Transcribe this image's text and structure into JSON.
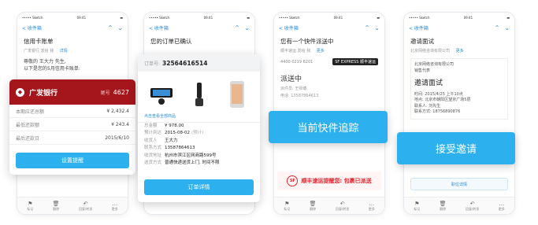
{
  "status_bar": {
    "carrier": "••••• Sketch",
    "time": "09:41"
  },
  "nav": {
    "back_label": "< 收件箱",
    "up_icon": "chevron-up",
    "down_icon": "chevron-down"
  },
  "tabbar": [
    {
      "icon": "flag-icon",
      "label": "标记"
    },
    {
      "icon": "trash-icon",
      "label": "删除"
    },
    {
      "icon": "reply-icon",
      "label": "回复/转发"
    },
    {
      "icon": "more-icon",
      "label": "更多"
    }
  ],
  "phone1": {
    "subject": "信用卡账单",
    "sender": "广发银行",
    "recipient_line": "发给 我",
    "detail_link": "详情",
    "greeting": "尊敬的 王大力 先生,",
    "intro": "以下是您的5月信用卡账单:"
  },
  "bank_card": {
    "bank_name": "广发银行",
    "tail_label": "尾号",
    "tail_number": "4627",
    "rows": [
      {
        "label": "本期应还总额",
        "value": "¥ 2,432.4"
      },
      {
        "label": "最低还款额",
        "value": "¥ 243.4"
      },
      {
        "label": "最后还款日",
        "value": "2015/6/10"
      }
    ],
    "button": "设置提醒"
  },
  "phone2": {
    "subject": "您的订单已确认"
  },
  "order_card": {
    "order_label": "订单号:",
    "order_number": "32564616514",
    "all_items": "点击查看全部商品",
    "fields": [
      {
        "k": "总金额",
        "v": "¥ 978.00",
        "note": ""
      },
      {
        "k": "预计到达",
        "v": "2015-08-02",
        "note": "(预计)"
      },
      {
        "k": "收货人",
        "v": "王大力",
        "note": ""
      },
      {
        "k": "联系方式",
        "v": "13587864613",
        "note": ""
      },
      {
        "k": "收货地址",
        "v": "杭州市滨江区网商路599号",
        "note": ""
      },
      {
        "k": "送货方式",
        "v": "普通快递送货上门, 时间不限",
        "note": ""
      }
    ],
    "button": "订单详情"
  },
  "phone3": {
    "subject": "您有一个快件派送中",
    "sender": "顺丰速运",
    "recipient_line": "发给 我",
    "more_link": "更多",
    "tracking": "4400 0219 8201",
    "express_logo": "SF EXPRESS 顺丰速运",
    "status": "派送中",
    "courier_name": "派件员: 王师傅",
    "courier_phone": "电话: 13587864613",
    "promo": "顺丰速运提醒您: 包裹已派送"
  },
  "banner_express": "当前快件追踪",
  "phone4": {
    "subject": "邀请面试",
    "sender": "北京网络咨询有限公司",
    "recipient_line": "发给 我",
    "more_link": "更多",
    "company": "北京网络咨询有限公司",
    "role": "销售代表",
    "heading": "邀请面试",
    "time": "时间: 2015/4/25 上午10点",
    "place": "地点: 北京市朝阳区望京广场5层",
    "contact": "联系人: 刘先生",
    "contact_phone": "联系方式: 18756890876",
    "detail_button": "职位详情"
  },
  "banner_invite": "接受邀请"
}
